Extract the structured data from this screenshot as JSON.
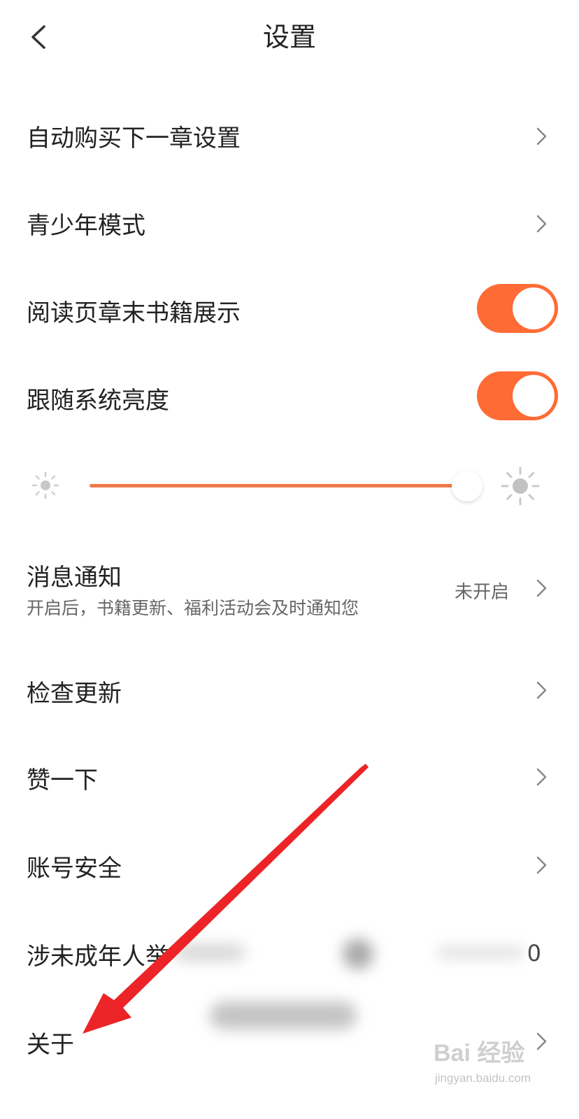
{
  "header": {
    "title": "设置"
  },
  "rows": [
    {
      "label": "自动购买下一章设置"
    },
    {
      "label": "青少年模式"
    },
    {
      "label": "阅读页章末书籍展示"
    },
    {
      "label": "跟随系统亮度"
    }
  ],
  "toggles": {
    "chapter_end_books": true,
    "follow_system_brightness": true
  },
  "brightness": {
    "level": 0.98
  },
  "notification": {
    "label": "消息通知",
    "description": "开启后，书籍更新、福利活动会及时通知您",
    "status": "未开启"
  },
  "items": [
    {
      "label": "检查更新"
    },
    {
      "label": "赞一下"
    },
    {
      "label": "账号安全"
    },
    {
      "label": "涉未成年人举",
      "value": "0"
    },
    {
      "label": "关于"
    }
  ],
  "watermark": {
    "brand": "Bai 经验",
    "url": "jingyan.baidu.com"
  },
  "colors": {
    "accent": "#ff6b35",
    "arrow": "#e8141a"
  },
  "icons": [
    "back-chevron-icon",
    "chevron-right-icon",
    "sun-small-icon",
    "sun-large-icon"
  ]
}
